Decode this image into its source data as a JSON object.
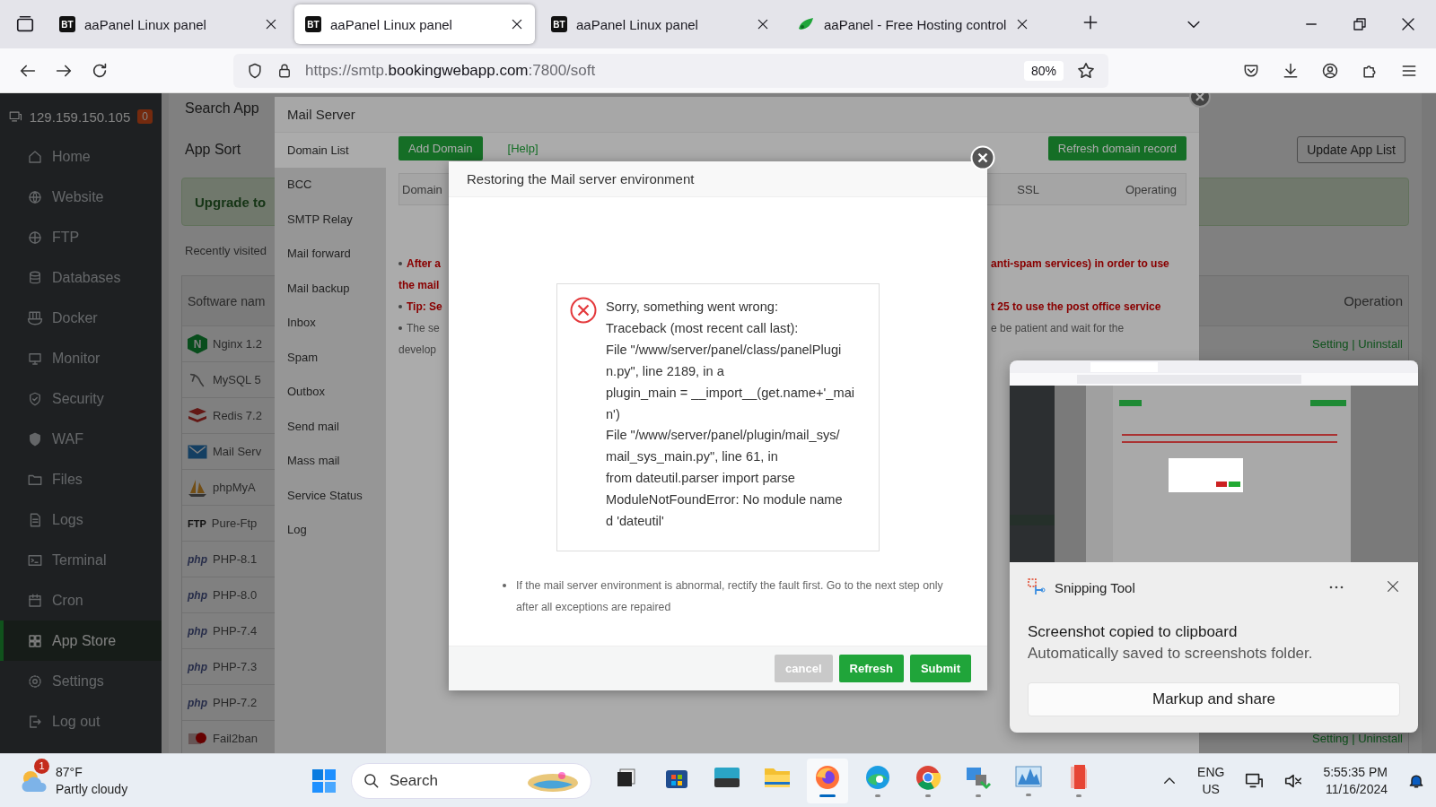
{
  "browser": {
    "tabs": [
      {
        "kind": "bt",
        "badge": "BT",
        "title": "aaPanel Linux panel",
        "selected": false
      },
      {
        "kind": "bt",
        "badge": "BT",
        "title": "aaPanel Linux panel",
        "selected": true
      },
      {
        "kind": "bt",
        "badge": "BT",
        "title": "aaPanel Linux panel",
        "selected": false
      },
      {
        "kind": "leaf",
        "title": "aaPanel - Free Hosting control",
        "selected": false
      }
    ],
    "address": {
      "scheme": "https://smtp.",
      "domain": "bookingwebapp.com",
      "path": ":7800/soft"
    },
    "zoom": "80%"
  },
  "sidebar": {
    "ip": "129.159.150.105",
    "alerts": "0",
    "items": [
      {
        "label": "Home",
        "selected": false
      },
      {
        "label": "Website",
        "selected": false
      },
      {
        "label": "FTP",
        "selected": false
      },
      {
        "label": "Databases",
        "selected": false
      },
      {
        "label": "Docker",
        "selected": false
      },
      {
        "label": "Monitor",
        "selected": false
      },
      {
        "label": "Security",
        "selected": false
      },
      {
        "label": "WAF",
        "selected": false
      },
      {
        "label": "Files",
        "selected": false
      },
      {
        "label": "Logs",
        "selected": false
      },
      {
        "label": "Terminal",
        "selected": false
      },
      {
        "label": "Cron",
        "selected": false
      },
      {
        "label": "App Store",
        "selected": true
      },
      {
        "label": "Settings",
        "selected": false
      },
      {
        "label": "Log out",
        "selected": false
      }
    ]
  },
  "app_store": {
    "search_label": "Search App",
    "sort_label": "App Sort",
    "update_button": "Update App List",
    "banner": "Upgrade to",
    "recent_label": "Recently visited",
    "columns": [
      "Software nam",
      "Operation"
    ],
    "rows": [
      {
        "kind": "nginx",
        "logo": "N",
        "name": "Nginx 1.2",
        "operation": "Setting | Uninstall"
      },
      {
        "kind": "mysql",
        "name": "MySQL 5"
      },
      {
        "kind": "redis",
        "name": "Redis 7.2"
      },
      {
        "kind": "mail",
        "name": "Mail Serv"
      },
      {
        "kind": "phpmyadmin",
        "name": "phpMyA"
      },
      {
        "kind": "ftp",
        "logo": "FTP",
        "name": "Pure-Ftp"
      },
      {
        "kind": "php",
        "logo": "php",
        "name": "PHP-8.1"
      },
      {
        "kind": "php",
        "logo": "php",
        "name": "PHP-8.0"
      },
      {
        "kind": "php",
        "logo": "php",
        "name": "PHP-7.4"
      },
      {
        "kind": "php",
        "logo": "php",
        "name": "PHP-7.3"
      },
      {
        "kind": "php",
        "logo": "php",
        "name": "PHP-7.2"
      },
      {
        "kind": "fail2ban",
        "name": "Fail2ban",
        "operation": "Setting | Uninstall"
      }
    ]
  },
  "mail_panel": {
    "title": "Mail Server",
    "nav": [
      {
        "label": "Domain List",
        "selected": true
      },
      {
        "label": "BCC",
        "selected": false
      },
      {
        "label": "SMTP Relay",
        "selected": false
      },
      {
        "label": "Mail forward",
        "selected": false
      },
      {
        "label": "Mail backup",
        "selected": false
      },
      {
        "label": "Inbox",
        "selected": false
      },
      {
        "label": "Spam",
        "selected": false
      },
      {
        "label": "Outbox",
        "selected": false
      },
      {
        "label": "Send mail",
        "selected": false
      },
      {
        "label": "Mass mail",
        "selected": false
      },
      {
        "label": "Service Status",
        "selected": false
      },
      {
        "label": "Log",
        "selected": false
      }
    ],
    "add_button": "Add Domain",
    "help_link": "[Help]",
    "refresh_button": "Refresh domain record",
    "columns": [
      "Domain",
      "SSL",
      "Operating"
    ],
    "notes": [
      {
        "kind": "warning",
        "left": "After a",
        "right": "anti-spam services) in order to use"
      },
      {
        "kind": "warning-cont",
        "left": "the mail"
      },
      {
        "kind": "warning",
        "left": "Tip: Se",
        "right": "t 25 to use the post office service"
      },
      {
        "kind": "info",
        "left": "The se",
        "right": "e be patient and wait for the"
      },
      {
        "kind": "info-cont",
        "left": "develop"
      }
    ]
  },
  "dialog": {
    "title": "Restoring the Mail server environment",
    "error_lines": [
      "Sorry, something went wrong:",
      "Traceback (most recent call last):",
      "File \"/www/server/panel/class/panelPlugi",
      "n.py\", line 2189, in a",
      "plugin_main = __import__(get.name+'_mai",
      "n')",
      "File \"/www/server/panel/plugin/mail_sys/",
      "mail_sys_main.py\", line 61, in",
      "from dateutil.parser import parse",
      "ModuleNotFoundError: No module name",
      "d 'dateutil'"
    ],
    "footnote": "If the mail server environment is abnormal, rectify the fault first. Go to the next step only after all exceptions are repaired",
    "buttons": [
      {
        "label": "cancel",
        "disabled": true
      },
      {
        "label": "Refresh",
        "disabled": false
      },
      {
        "label": "Submit",
        "disabled": false
      }
    ]
  },
  "toast": {
    "app": "Snipping Tool",
    "title": "Screenshot copied to clipboard",
    "body": "Automatically saved to screenshots folder.",
    "action": "Markup and share"
  },
  "taskbar": {
    "weather": {
      "badge": "1",
      "temp": "87°F",
      "condition": "Partly cloudy"
    },
    "search": "Search",
    "apps": [
      {
        "running": false,
        "active": false
      },
      {
        "running": false,
        "active": false
      },
      {
        "running": false,
        "active": false
      },
      {
        "running": false,
        "active": false
      },
      {
        "running": true,
        "active": true
      },
      {
        "running": true,
        "active": false
      },
      {
        "running": true,
        "active": false
      },
      {
        "running": true,
        "active": false
      },
      {
        "running": true,
        "active": false
      },
      {
        "running": true,
        "active": false
      }
    ],
    "lang": "ENG",
    "region": "US",
    "time": "5:55:35 PM",
    "date": "11/16/2024"
  }
}
